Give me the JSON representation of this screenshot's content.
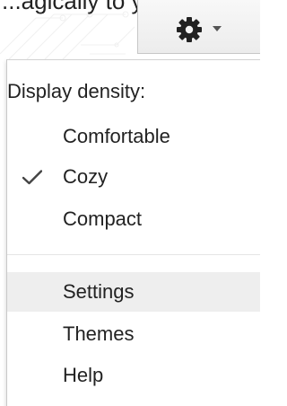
{
  "header": {
    "cut_text": "...agically to you.",
    "settings_button": {
      "icon": "gear-icon",
      "dropdown_icon": "caret-down-icon"
    }
  },
  "menu": {
    "title": "Display density:",
    "density_options": [
      {
        "label": "Comfortable",
        "selected": false
      },
      {
        "label": "Cozy",
        "selected": true
      },
      {
        "label": "Compact",
        "selected": false
      }
    ],
    "actions": [
      {
        "label": "Settings",
        "hovered": true
      },
      {
        "label": "Themes",
        "hovered": false
      },
      {
        "label": "Help",
        "hovered": false
      }
    ],
    "check_icon": "checkmark-icon"
  },
  "colors": {
    "text": "#222222",
    "hover_background": "#eeeeee",
    "separator": "#e5e5e5",
    "button_border": "#c6c6c6"
  }
}
